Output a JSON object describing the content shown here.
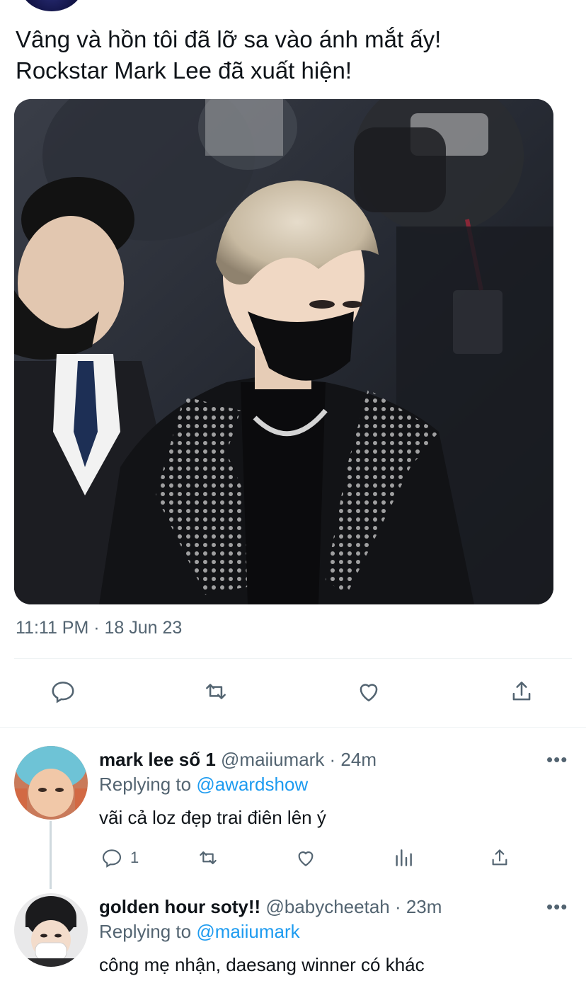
{
  "tweet": {
    "text_line1": "Vâng và hồn tôi đã lỡ sa vào ánh mắt ấy!",
    "text_line2": "Rockstar Mark Lee đã xuất hiện!",
    "timestamp": "11:11 PM · 18 Jun 23",
    "media_icon": "photo"
  },
  "replies": [
    {
      "name": "mark lee số 1",
      "handle": "@maiiumark · 24m",
      "replying_prefix": "Replying to ",
      "replying_to": "@awardshow",
      "text": "vãi cả loz đẹp trai điên lên ý",
      "reply_count": "1",
      "more": "•••"
    },
    {
      "name": "golden hour soty!!",
      "handle": "@babycheetah · 23m",
      "replying_prefix": "Replying to ",
      "replying_to": "@maiiumark",
      "text": "công mẹ nhận, daesang winner có khác",
      "more": "•••"
    }
  ],
  "colors": {
    "text": "#0f1419",
    "secondary": "#536471",
    "link": "#1d9bf0",
    "divider": "#eff3f4"
  }
}
